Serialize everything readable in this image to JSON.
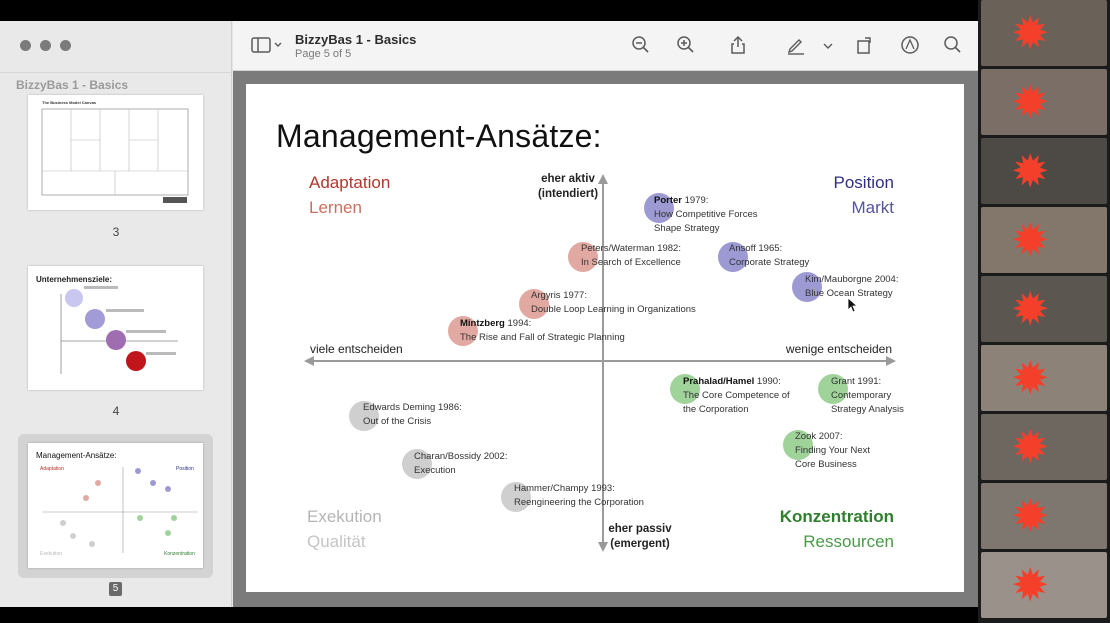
{
  "app": {
    "doc_title": "BizzyBas 1 - Basics",
    "page_info": "Page 5 of 5"
  },
  "sidebar": {
    "title": "BizzyBas 1 - Basics",
    "thumbs": [
      {
        "page": "3",
        "heading": "The Business Model Canvas"
      },
      {
        "page": "4",
        "heading": "Unternehmensziele:"
      },
      {
        "page": "5",
        "heading": "Management-Ansätze:"
      }
    ]
  },
  "slide": {
    "title": "Management-Ansätze:",
    "quadrants": {
      "top_left": {
        "line1": "Adaptation",
        "line2": "Lernen"
      },
      "top_right": {
        "line1": "Position",
        "line2": "Markt"
      },
      "bottom_left": {
        "line1": "Exekution",
        "line2": "Qualität"
      },
      "bottom_right": {
        "line1": "Konzentration",
        "line2": "Ressourcen"
      }
    },
    "axis": {
      "top": "eher aktiv\n(intendiert)",
      "bottom": "eher passiv\n(emergent)",
      "left": "viele entscheiden",
      "right": "wenige entscheiden"
    },
    "entries": [
      {
        "id": "porter",
        "bold": "Porter",
        "rest": " 1979:",
        "l2": "How Competitive Forces",
        "l3": "Shape Strategy",
        "color": "#9d9ad3"
      },
      {
        "id": "peters",
        "bold": "",
        "rest": "Peters/Waterman 1982:",
        "l2": "In Search of Excellence",
        "l3": "",
        "color": "#e2a9a3"
      },
      {
        "id": "ansoff",
        "bold": "",
        "rest": "Ansoff 1965:",
        "l2": "Corporate Strategy",
        "l3": "",
        "color": "#9d9ad3"
      },
      {
        "id": "kim",
        "bold": "",
        "rest": "Kim/Mauborgne 2004:",
        "l2": "Blue Ocean Strategy",
        "l3": "",
        "color": "#9d9ad3"
      },
      {
        "id": "argyris",
        "bold": "",
        "rest": "Argyris 1977:",
        "l2": "Double Loop Learning in Organizations",
        "l3": "",
        "color": "#e2a9a3"
      },
      {
        "id": "mintzberg",
        "bold": "Mintzberg",
        "rest": " 1994:",
        "l2": "The Rise and Fall of Strategic Planning",
        "l3": "",
        "color": "#e2a9a3"
      },
      {
        "id": "prahalad",
        "bold": "Prahalad/Hamel",
        "rest": " 1990:",
        "l2": "The Core Competence of",
        "l3": "the Corporation",
        "color": "#9fd39a"
      },
      {
        "id": "grant",
        "bold": "",
        "rest": "Grant 1991:",
        "l2": "Contemporary",
        "l3": "Strategy Analysis",
        "color": "#9fd39a"
      },
      {
        "id": "deming",
        "bold": "",
        "rest": "Edwards Deming 1986:",
        "l2": "Out of the Crisis",
        "l3": "",
        "color": "#cfcfcf"
      },
      {
        "id": "zook",
        "bold": "",
        "rest": "Zook 2007:",
        "l2": "Finding Your Next",
        "l3": "Core Business",
        "color": "#9fd39a"
      },
      {
        "id": "charan",
        "bold": "",
        "rest": "Charan/Bossidy 2002:",
        "l2": "Execution",
        "l3": "",
        "color": "#cfcfcf"
      },
      {
        "id": "hammer",
        "bold": "",
        "rest": "Hammer/Champy 1993:",
        "l2": "Reengineering the Corporation",
        "l3": "",
        "color": "#cfcfcf"
      }
    ]
  },
  "colors": {
    "adaptation": "#b2352e",
    "lernen": "#c9705f",
    "position": "#2f2f84",
    "markt": "#55559a",
    "exekution": "#b5b5b5",
    "konzentration": "#2f7f2e",
    "ressourcen": "#4c9a48"
  },
  "icons": [
    "sidebar-toggle-icon",
    "zoom-out-icon",
    "zoom-in-icon",
    "share-icon",
    "markup-pen-icon",
    "rotate-icon",
    "annotate-icon",
    "search-icon"
  ]
}
